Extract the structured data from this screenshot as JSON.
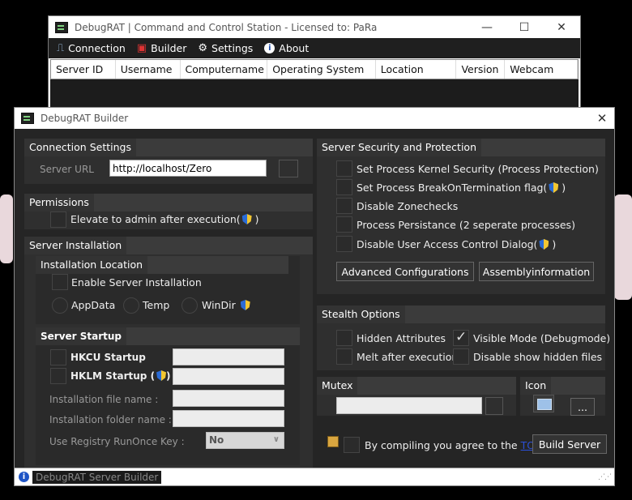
{
  "main_window": {
    "title": "DebugRAT  |  Command and Control Station  -  Licensed to: PaRa",
    "menu": [
      {
        "label": "Connection",
        "icon": "plug-icon"
      },
      {
        "label": "Builder",
        "icon": "builder-icon"
      },
      {
        "label": "Settings",
        "icon": "gear-icon"
      },
      {
        "label": "About",
        "icon": "info-icon"
      }
    ],
    "columns": [
      "Server ID",
      "Username",
      "Computername",
      "Operating System",
      "Location",
      "Version",
      "Webcam"
    ]
  },
  "builder": {
    "title": "DebugRAT Builder",
    "connection": {
      "header": "Connection Settings",
      "url_label": "Server URL",
      "url_value": "http://localhost/Zero"
    },
    "permissions": {
      "header": "Permissions",
      "elevate_label": "Elevate to admin after execution(",
      "elevate_suffix": ")"
    },
    "installation": {
      "header": "Server Installation",
      "location_header": "Installation Location",
      "enable_label": "Enable Server Installation",
      "radios": [
        "AppData",
        "Temp",
        "WinDir"
      ],
      "startup_header": "Server Startup",
      "hkcu_label": "HKCU Startup",
      "hklm_label": "HKLM Startup",
      "hklm_open": "(",
      "hklm_close": ")",
      "file_name_label": "Installation file name :",
      "folder_name_label": "Installation folder name :",
      "runonce_label": "Use Registry RunOnce Key :",
      "runonce_value": "No"
    },
    "security": {
      "header": "Server Security and Protection",
      "items": [
        "Set Process Kernel Security (Process Protection)",
        "Set Process BreakOnTermination flag(",
        "Disable Zonechecks",
        "Process Persistance (2 seperate processes)",
        "Disable User Access Control Dialog("
      ],
      "close_paren": ")",
      "advanced_button": "Advanced Configurations",
      "assembly_button": "Assemblyinformation"
    },
    "stealth": {
      "header": "Stealth Options",
      "hidden_attributes": "Hidden Attributes",
      "visible_mode": "Visible Mode (Debugmode)",
      "melt": "Melt after execution",
      "disable_hidden": "Disable show hidden files"
    },
    "mutex": {
      "header": "Mutex"
    },
    "icon": {
      "header": "Icon",
      "browse_button": "..."
    },
    "footer": {
      "agree_text": "By compiling you agree to the",
      "tos_link": "TOS",
      "build_button": "Build Server"
    },
    "status_text": "DebugRAT Server Builder"
  }
}
